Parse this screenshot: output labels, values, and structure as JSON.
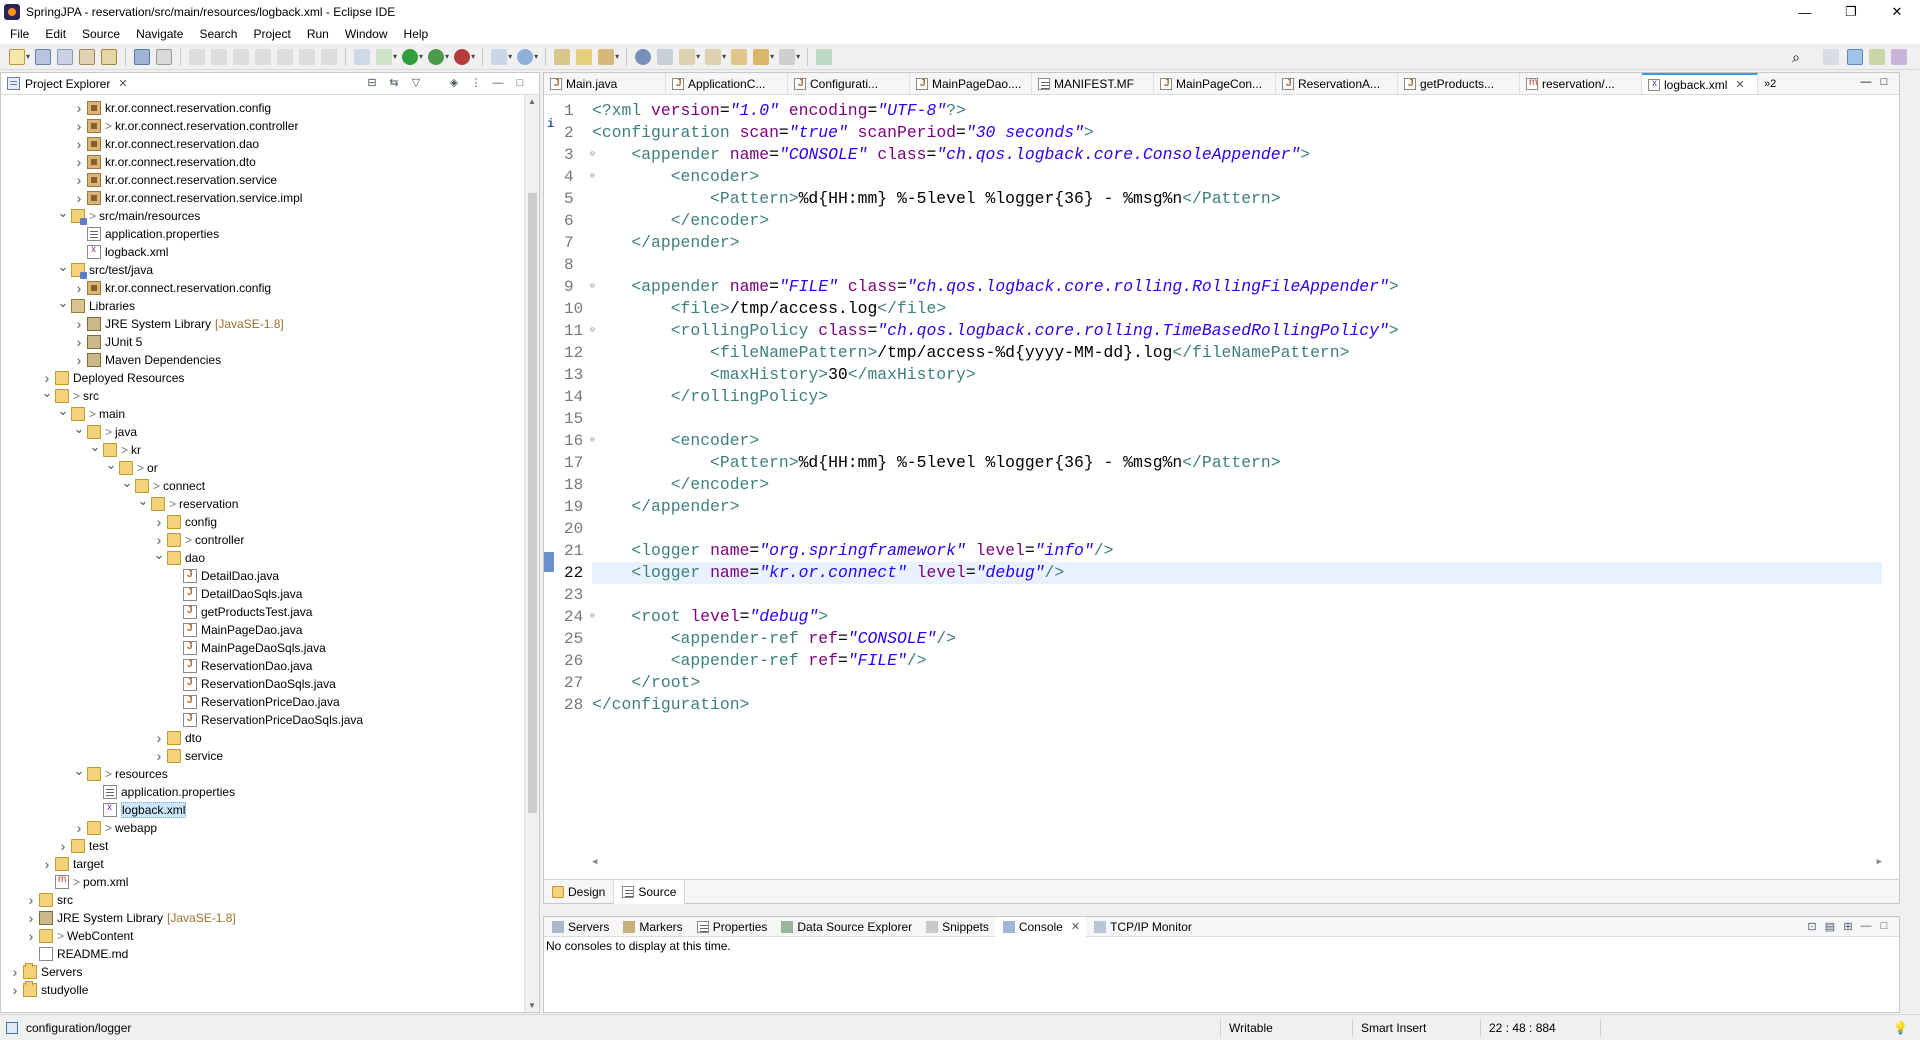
{
  "window": {
    "title": "SpringJPA - reservation/src/main/resources/logback.xml - Eclipse IDE",
    "controls": [
      "—",
      "❐",
      "✕"
    ]
  },
  "menu": [
    "File",
    "Edit",
    "Source",
    "Navigate",
    "Search",
    "Project",
    "Run",
    "Window",
    "Help"
  ],
  "project_explorer": {
    "title": "Project Explorer",
    "tree": [
      {
        "label": "kr.or.connect.reservation.config",
        "icon": "package-icon",
        "prefix": ""
      },
      {
        "label": "kr.or.connect.reservation.controller",
        "icon": "package-icon",
        "prefix": ">"
      },
      {
        "label": "kr.or.connect.reservation.dao",
        "icon": "package-icon",
        "prefix": ""
      },
      {
        "label": "kr.or.connect.reservation.dto",
        "icon": "package-icon",
        "prefix": ""
      },
      {
        "label": "kr.or.connect.reservation.service",
        "icon": "package-icon",
        "prefix": ""
      },
      {
        "label": "kr.or.connect.reservation.service.impl",
        "icon": "package-icon",
        "prefix": ""
      },
      {
        "label": "src/main/resources",
        "icon": "source-folder-icon",
        "prefix": ">"
      },
      {
        "label": "application.properties",
        "icon": "properties-file-icon",
        "prefix": ""
      },
      {
        "label": "logback.xml",
        "icon": "xml-file-icon",
        "prefix": ""
      },
      {
        "label": "src/test/java",
        "icon": "source-folder-icon",
        "prefix": ""
      },
      {
        "label": "kr.or.connect.reservation.config",
        "icon": "package-icon",
        "prefix": ""
      },
      {
        "label": "Libraries",
        "icon": "library-icon",
        "prefix": ""
      },
      {
        "label": "JRE System Library",
        "icon": "jar-icon",
        "prefix": "",
        "suffix": "[JavaSE-1.8]"
      },
      {
        "label": "JUnit 5",
        "icon": "jar-icon",
        "prefix": ""
      },
      {
        "label": "Maven Dependencies",
        "icon": "jar-icon",
        "prefix": ""
      },
      {
        "label": "Deployed Resources",
        "icon": "folder-icon",
        "prefix": ""
      },
      {
        "label": "src",
        "icon": "folder-icon",
        "prefix": ">"
      },
      {
        "label": "main",
        "icon": "folder-icon",
        "prefix": ">"
      },
      {
        "label": "java",
        "icon": "folder-icon",
        "prefix": ">"
      },
      {
        "label": "kr",
        "icon": "folder-icon",
        "prefix": ">"
      },
      {
        "label": "or",
        "icon": "folder-icon",
        "prefix": ">"
      },
      {
        "label": "connect",
        "icon": "folder-icon",
        "prefix": ">"
      },
      {
        "label": "reservation",
        "icon": "folder-icon",
        "prefix": ">"
      },
      {
        "label": "config",
        "icon": "folder-icon",
        "prefix": ""
      },
      {
        "label": "controller",
        "icon": "folder-icon",
        "prefix": ">"
      },
      {
        "label": "dao",
        "icon": "folder-icon",
        "prefix": ""
      },
      {
        "label": "DetailDao.java",
        "icon": "java-file-icon",
        "prefix": ""
      },
      {
        "label": "DetailDaoSqls.java",
        "icon": "java-file-icon",
        "prefix": ""
      },
      {
        "label": "getProductsTest.java",
        "icon": "java-file-icon",
        "prefix": ""
      },
      {
        "label": "MainPageDao.java",
        "icon": "java-file-icon",
        "prefix": ""
      },
      {
        "label": "MainPageDaoSqls.java",
        "icon": "java-file-icon",
        "prefix": ""
      },
      {
        "label": "ReservationDao.java",
        "icon": "java-file-icon",
        "prefix": ""
      },
      {
        "label": "ReservationDaoSqls.java",
        "icon": "java-file-icon",
        "prefix": ""
      },
      {
        "label": "ReservationPriceDao.java",
        "icon": "java-file-icon",
        "prefix": ""
      },
      {
        "label": "ReservationPriceDaoSqls.java",
        "icon": "java-file-icon",
        "prefix": ""
      },
      {
        "label": "dto",
        "icon": "folder-icon",
        "prefix": ""
      },
      {
        "label": "service",
        "icon": "folder-icon",
        "prefix": ""
      },
      {
        "label": "resources",
        "icon": "folder-icon",
        "prefix": ">"
      },
      {
        "label": "application.properties",
        "icon": "properties-file-icon",
        "prefix": ""
      },
      {
        "label": "logback.xml",
        "icon": "xml-file-icon",
        "prefix": ""
      },
      {
        "label": "webapp",
        "icon": "folder-icon",
        "prefix": ">"
      },
      {
        "label": "test",
        "icon": "folder-icon",
        "prefix": ""
      },
      {
        "label": "target",
        "icon": "folder-icon",
        "prefix": ""
      },
      {
        "label": "pom.xml",
        "icon": "maven-file-icon",
        "prefix": ">"
      },
      {
        "label": "src",
        "icon": "folder-icon",
        "prefix": ""
      },
      {
        "label": "JRE System Library",
        "icon": "jar-icon",
        "prefix": "",
        "suffix": "[JavaSE-1.8]"
      },
      {
        "label": "WebContent",
        "icon": "folder-icon",
        "prefix": ">"
      },
      {
        "label": "README.md",
        "icon": "markdown-file-icon",
        "prefix": ""
      },
      {
        "label": "Servers",
        "icon": "project-icon",
        "prefix": ""
      },
      {
        "label": "studyolle",
        "icon": "project-icon",
        "prefix": ""
      }
    ]
  },
  "editor": {
    "tabs": [
      "Main.java",
      "ApplicationC...",
      "Configurati...",
      "MainPageDao....",
      "MANIFEST.MF",
      "MainPageCon...",
      "ReservationA...",
      "getProducts...",
      "reservation/...",
      "logback.xml"
    ],
    "active_tab": "logback.xml",
    "more_tabs": "»2",
    "current_line": 22,
    "line_numbers": [
      "1",
      "2",
      "3",
      "4",
      "5",
      "6",
      "7",
      "8",
      "9",
      "10",
      "11",
      "12",
      "13",
      "14",
      "15",
      "16",
      "17",
      "18",
      "19",
      "20",
      "21",
      "22",
      "23",
      "24",
      "25",
      "26",
      "27",
      "28"
    ],
    "code": [
      "<?xml version=\"1.0\" encoding=\"UTF-8\"?>",
      "<configuration scan=\"true\" scanPeriod=\"30 seconds\">",
      "    <appender name=\"CONSOLE\" class=\"ch.qos.logback.core.ConsoleAppender\">",
      "        <encoder>",
      "            <Pattern>%d{HH:mm} %-5level %logger{36} - %msg%n</Pattern>",
      "        </encoder>",
      "    </appender>",
      "",
      "    <appender name=\"FILE\" class=\"ch.qos.logback.core.rolling.RollingFileAppender\">",
      "        <file>/tmp/access.log</file>",
      "        <rollingPolicy class=\"ch.qos.logback.core.rolling.TimeBasedRollingPolicy\">",
      "            <fileNamePattern>/tmp/access-%d{yyyy-MM-dd}.log</fileNamePattern>",
      "            <maxHistory>30</maxHistory>",
      "        </rollingPolicy>",
      "",
      "        <encoder>",
      "            <Pattern>%d{HH:mm} %-5level %logger{36} - %msg%n</Pattern>",
      "        </encoder>",
      "    </appender>",
      "",
      "    <logger name=\"org.springframework\" level=\"info\"/>",
      "    <logger name=\"kr.or.connect\" level=\"debug\"/>",
      "",
      "    <root level=\"debug\">",
      "        <appender-ref ref=\"CONSOLE\"/>",
      "        <appender-ref ref=\"FILE\"/>",
      "    </root>",
      "</configuration>"
    ],
    "fold_lines": [
      3,
      4,
      9,
      11,
      16,
      24
    ],
    "sub_tabs": [
      "Design",
      "Source"
    ],
    "active_sub_tab": "Source"
  },
  "bottom_panel": {
    "tabs": [
      "Servers",
      "Markers",
      "Properties",
      "Data Source Explorer",
      "Snippets",
      "Console",
      "TCP/IP Monitor"
    ],
    "active_tab": "Console",
    "message": "No consoles to display at this time."
  },
  "status_bar": {
    "path": "configuration/logger",
    "mode": "Writable",
    "insert": "Smart Insert",
    "position": "22 : 48 : 884"
  },
  "colors": {
    "tag": "#3f7f7f",
    "attribute": "#7f007f",
    "value": "#2a00ff",
    "current_line": "#e8f2fe",
    "selection": "#cce8ff"
  }
}
